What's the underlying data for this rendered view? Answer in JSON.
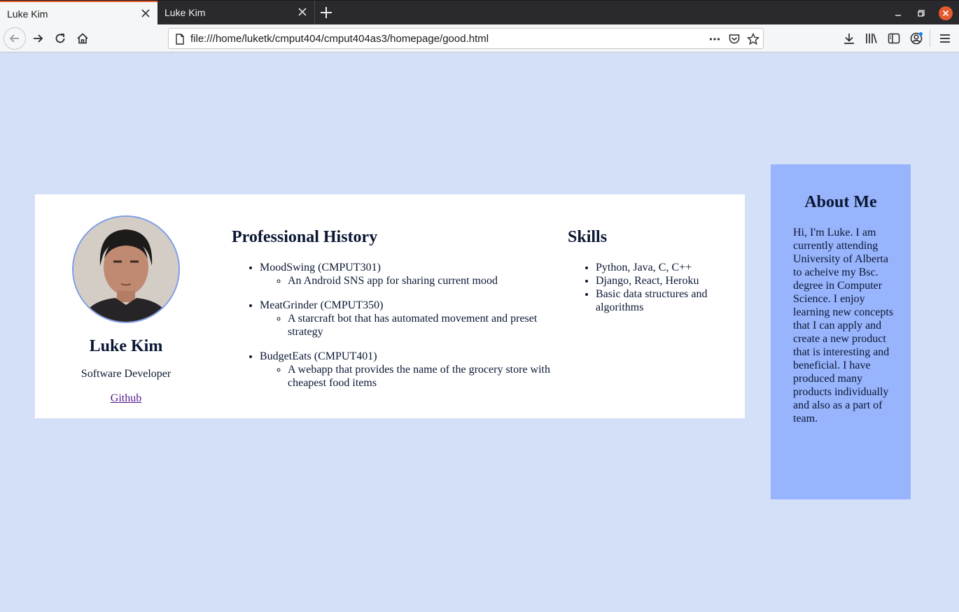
{
  "browser": {
    "tabs": [
      {
        "title": "Luke Kim",
        "active": true
      },
      {
        "title": "Luke Kim",
        "active": false
      }
    ],
    "url": "file:///home/luketk/cmput404/cmput404as3/homepage/good.html",
    "accent_color": "#e55b2f"
  },
  "profile": {
    "name": "Luke Kim",
    "role": "Software Developer",
    "link_label": "Github"
  },
  "history": {
    "heading": "Professional History",
    "items": [
      {
        "title": "MoodSwing (CMPUT301)",
        "detail": "An Android SNS app for sharing current mood"
      },
      {
        "title": "MeatGrinder (CMPUT350)",
        "detail": "A starcraft bot that has automated movement and preset strategy"
      },
      {
        "title": "BudgetEats (CMPUT401)",
        "detail": "A webapp that provides the name of the grocery store with cheapest food items"
      }
    ]
  },
  "skills": {
    "heading": "Skills",
    "items": [
      "Python, Java, C, C++",
      "Django, React, Heroku",
      "Basic data structures and algorithms"
    ]
  },
  "about": {
    "heading": "About Me",
    "text": "Hi, I'm Luke. I am currently attending University of Alberta to acheive my Bsc. degree in Computer Science. I enjoy learning new concepts that I can apply and create a new product that is interesting and beneficial. I have produced many products individually and also as a part of team."
  },
  "colors": {
    "page_bg": "#d4dff8",
    "about_bg": "#98b4fc",
    "text": "#0a1733"
  }
}
